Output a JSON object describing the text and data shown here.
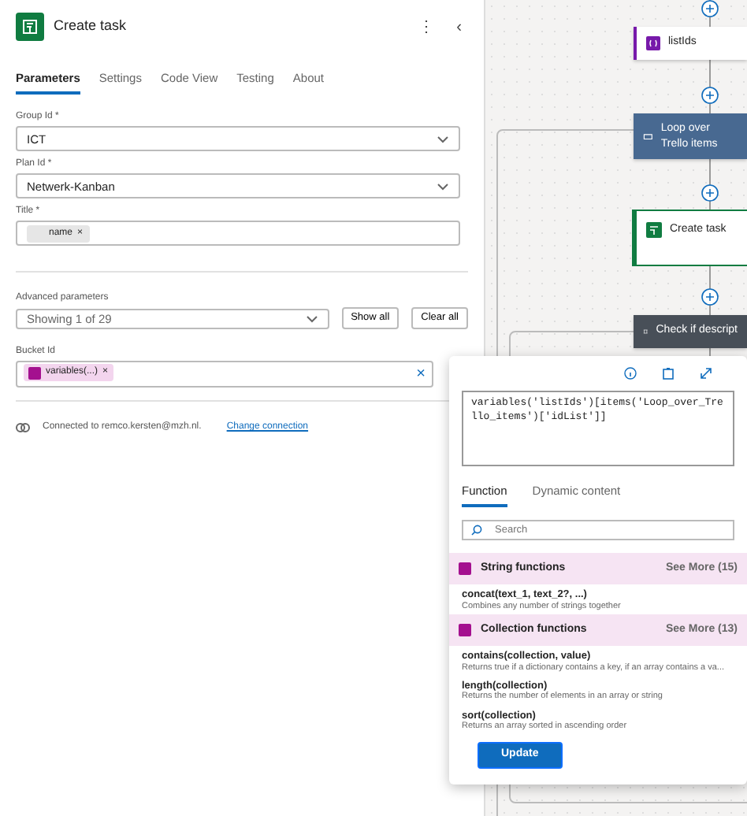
{
  "panel": {
    "title": "Create task",
    "more": "⋮",
    "collapse": "‹",
    "tabs": [
      {
        "label": "Parameters",
        "selected": true
      },
      {
        "label": "Settings",
        "selected": false
      },
      {
        "label": "Code View",
        "selected": false
      },
      {
        "label": "Testing",
        "selected": false
      },
      {
        "label": "About",
        "selected": false
      }
    ],
    "fields": [
      {
        "kind": "select",
        "label": "Group Id *",
        "value": "ICT"
      },
      {
        "kind": "select",
        "label": "Plan Id *",
        "value": "Netwerk-Kanban"
      },
      {
        "kind": "token",
        "label": "Title *",
        "token": "name",
        "remove": "×"
      }
    ],
    "advanced": {
      "label": "Advanced parameters",
      "value": "Showing 1 of 29",
      "buttons": [
        "Show all",
        "Clear all"
      ]
    },
    "bucket": {
      "label": "Bucket Id",
      "token": "variables(...)",
      "remove": "×",
      "clear": "×"
    },
    "connection": {
      "text": "Connected to remco.kersten@mzh.nl.",
      "link": "Change connection"
    }
  },
  "canvas": {
    "nodes": [
      {
        "kind": "variable",
        "label": "listIds"
      },
      {
        "kind": "loop",
        "label": "Loop over Trello items"
      },
      {
        "kind": "action",
        "label": "Create task",
        "selected": true
      },
      {
        "kind": "condition",
        "label": "Check if descript"
      }
    ]
  },
  "editor": {
    "expression": "variables('listIds')[items('Loop_over_Trello_items')['idList']]",
    "tabs": [
      {
        "label": "Function",
        "selected": true
      },
      {
        "label": "Dynamic content",
        "selected": false
      }
    ],
    "search": {
      "placeholder": "Search"
    },
    "groups": [
      {
        "name": "String functions",
        "more": "See More (15)",
        "functions": [
          {
            "signature": "concat(text_1, text_2?, ...)",
            "description": "Combines any number of strings together"
          }
        ]
      },
      {
        "name": "Collection functions",
        "more": "See More (13)",
        "functions": [
          {
            "signature": "contains(collection, value)",
            "description": "Returns true if a dictionary contains a key, if an array contains a va..."
          },
          {
            "signature": "length(collection)",
            "description": "Returns the number of elements in an array or string"
          },
          {
            "signature": "sort(collection)",
            "description": "Returns an array sorted in ascending order"
          }
        ]
      }
    ],
    "button": "Update"
  }
}
